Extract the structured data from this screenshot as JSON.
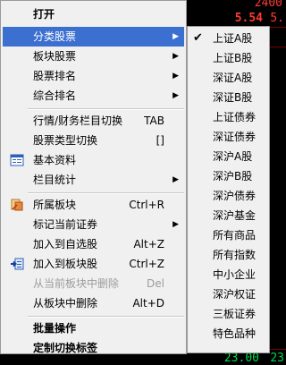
{
  "background": {
    "top_value": "2400",
    "red_value": "5.54",
    "red_value_right": "5.",
    "green_value": "23.00",
    "green_value_right": "23"
  },
  "context_menu": {
    "items": [
      {
        "label": "打开",
        "bold": true
      },
      {
        "label": "分类股票",
        "submenu": true,
        "highlighted": true
      },
      {
        "label": "板块股票",
        "submenu": true
      },
      {
        "label": "股票排名",
        "submenu": true
      },
      {
        "label": "综合排名",
        "submenu": true
      },
      {
        "label": "行情/财务栏目切换",
        "shortcut": "TAB"
      },
      {
        "label": "股票类型切换",
        "shortcut": "[]"
      },
      {
        "label": "基本资料",
        "icon": "info-card-icon"
      },
      {
        "label": "栏目统计",
        "submenu": true
      },
      {
        "label": "所属板块",
        "shortcut": "Ctrl+R",
        "icon": "sector-icon"
      },
      {
        "label": "标记当前证券",
        "submenu": true
      },
      {
        "label": "加入到自选股",
        "shortcut": "Alt+Z"
      },
      {
        "label": "加入到板块股",
        "shortcut": "Ctrl+Z",
        "icon": "add-to-sector-icon"
      },
      {
        "label": "从当前板块中删除",
        "shortcut": "Del",
        "disabled": true
      },
      {
        "label": "从板块中删除",
        "shortcut": "Alt+D"
      },
      {
        "label": "批量操作",
        "bold": true
      },
      {
        "label": "定制切换标签",
        "bold": true
      }
    ]
  },
  "submenu": {
    "items": [
      {
        "label": "上证A股",
        "checked": true
      },
      {
        "label": "上证B股"
      },
      {
        "label": "深证A股"
      },
      {
        "label": "深证B股"
      },
      {
        "label": "上证债券"
      },
      {
        "label": "深证债券"
      },
      {
        "label": "深沪A股"
      },
      {
        "label": "深沪B股"
      },
      {
        "label": "深沪债券"
      },
      {
        "label": "深沪基金"
      },
      {
        "label": "所有商品"
      },
      {
        "label": "所有指数"
      },
      {
        "label": "中小企业"
      },
      {
        "label": "深沪权证"
      },
      {
        "label": "三板证券"
      },
      {
        "label": "特色品种"
      }
    ]
  }
}
